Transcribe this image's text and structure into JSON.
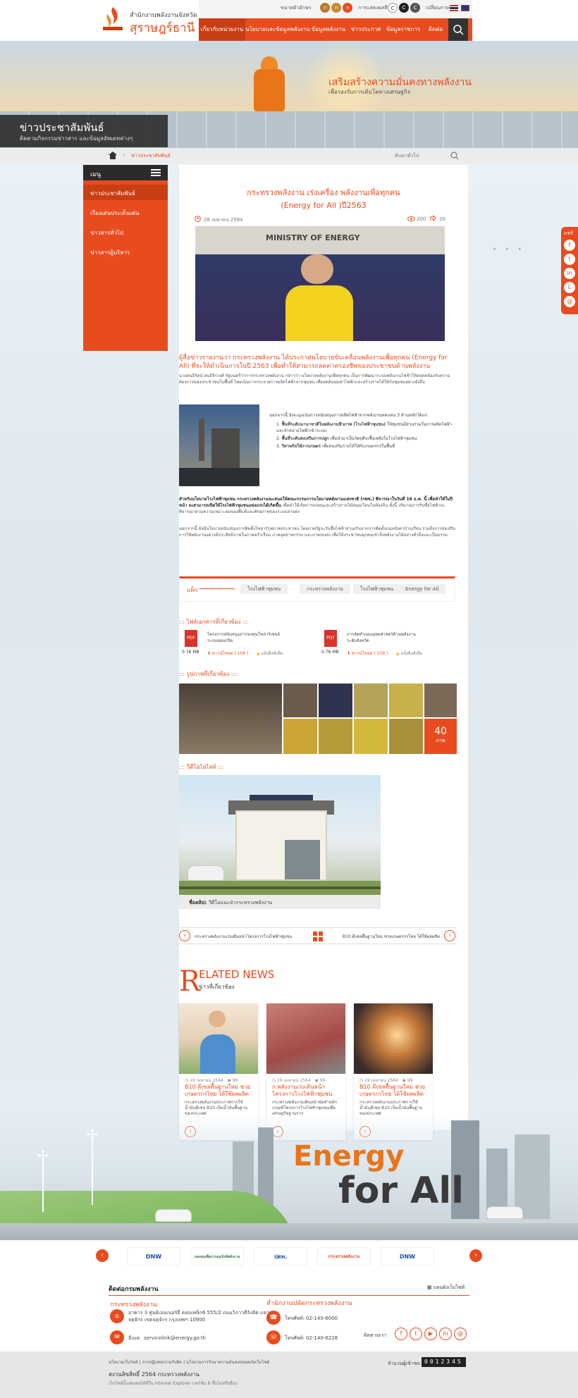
{
  "header": {
    "org_small": "สำนักงานพลังงานจังหวัด",
    "org_main": "สุราษฎร์ธานี",
    "font_size_label": "ขนาดตัวอักษร",
    "font_sizes": [
      "ก",
      "ก",
      "ก"
    ],
    "contrast_label": "การแสดงผลสี",
    "contrast_options": [
      "C",
      "C",
      "C"
    ],
    "lang_label": "เปลี่ยนภาษา",
    "nav": [
      "เกี่ยวกับหน่วยงาน",
      "นโยบายและข้อมูลพลังงาน",
      "ข้อมูลพลังงาน",
      "ข่าวประกาศ",
      "ข้อมูลราชการ",
      "ติดต่อ"
    ]
  },
  "banner": {
    "headline": "เสริมสร้างความมั่นคงทางพลังงาน",
    "sub": "เพื่อรองรับการเติบโตทางเศรษฐกิจ",
    "section_title": "ข่าวประชาสัมพันธ์",
    "section_sub": "ติดตามกิจกรรมข่าวสาร และข้อมูลอัพเดทต่างๆ"
  },
  "breadcrumb": {
    "current": "ข่าวประชาสัมพันธ์",
    "search_label": "ค้นหาทั่วไป"
  },
  "sidebar": {
    "title": "เมนู",
    "items": [
      "ข่าวประชาสัมพันธ์",
      "เรื่องเด่นประเด็นเด่น",
      "ข่าวสารทั่วไป",
      "ข่าวสารผู้บริหาร"
    ]
  },
  "share": {
    "label": "แชร์",
    "icons": [
      "f",
      "t",
      "in",
      "L",
      "@"
    ]
  },
  "article": {
    "title_line1": "กระทรวงพลังงาน เร่งเครื่อง พลังงานเพื่อทุกคน",
    "title_line2": "(Energy for All )ปี2563",
    "date": "28 เมษายน 2564",
    "views": "200",
    "shares": "20",
    "photo_banner": "MINISTRY OF ENERGY",
    "lead": "ผู้สื่อข่าวรายงานว่า กระทรวงพลังงาน ได้ประกาศนโยบายขับเคลื่อนพลังงานเพื่อทุกคน (Energy for All) ที่จะให้ดำเนินการในปี 2563 เพื่อทำให้สามารถลดค่าครองชีพของประชาชนด้านพลังงาน",
    "intro": "นายสนธิรัตน์ สนธิจิรวงศ์ รัฐมนตรีว่าการกระทรวงพลังงาน กล่าวว่า นโยบายพลังงานเพื่อทุกคน เป็นการพัฒนาระบบพลังงานไฟฟ้าให้สอดคล้องกับความต้องการของประชาชนในพื้นที่ โดยเน้นการกระจายการผลิตไฟฟ้าจากชุมชน เพื่อลดต้นทุนค่าไฟฟ้าและสร้างรายได้ให้กับชุมชนอย่างยั่งยืน",
    "bullet_intro": "นอกจากนี้ ยังจะมุ่งเน้นการสนับสนุนการผลิตไฟฟ้าจากพลังงานทดแทน 3 ด้านหลักได้แก่",
    "bullets": [
      {
        "bold": "ฟื้นที่ระดับนานาชาติในพลังงานชีวภาพ (โรงไฟฟ้าชุมชน)",
        "rest": " ให้ชุมชนมีส่วนร่วมในการผลิตไฟฟ้าและจำหน่ายไฟฟ้าเข้าระบบ"
      },
      {
        "bold": "พื้นที่ระดับส่งเสริมการปลูก",
        "rest": " เพื่อนำมาเป็นวัตถุดิบเชื้อเพลิงในโรงไฟฟ้าชุมชน"
      },
      {
        "bold": "วิสาหกิจให้การเกษตร",
        "rest": " เพื่อส่งเสริมรายได้ให้กับเกษตรกรในพื้นที่"
      }
    ],
    "para2_bold": "สำหรับนโยบายโรงไฟฟ้าชุมชน กระทรวงพลังงานจะเสนอให้คณะกรรมการนโยบายพลังงานแห่งชาติ (กพช.) พิจารณาในวันที่ 16 ธ.ค. นี้ เพื่อทำให้ในปีหน้า จะสามารถเปิดให้โรงไฟฟ้าชุมชนแห่งแรกได้เกิดขึ้น",
    "para2": " เพื่อทำให้เกิดการลงทุนและสร้างรายได้หมุนเวียนในท้องถิ่น ทั้งนี้ ปริมาณการรับซื้อไฟฟ้าจะพิจารณาตามความเหมาะสมของพื้นที่และศักยภาพของระบบสายส่ง",
    "para3": "นอกจากนี้ ยังมีนโยบายสนับสนุนการติดตั้งโซลาร์รูฟภาคประชาชน โดยภาครัฐจะรับซื้อไฟฟ้าส่วนเกินจากการติดตั้งบนหลังคาบ้านเรือน รวมถึงการส่งเสริมการใช้พลังงานอย่างมีประสิทธิภาพในภาคครัวเรือน ภาคอุตสาหกรรม และภาคขนส่ง เพื่อให้ประชาชนทุกคนเข้าถึงพลังงานได้อย่างทั่วถึงและเป็นธรรม"
  },
  "tags": {
    "label": "แท็ก",
    "items": [
      "โรงไฟฟ้าชุมชน",
      "กระทรวงพลังงาน",
      "โรงไฟฟ้าชุมชน",
      "Energy for All"
    ]
  },
  "files": {
    "title": "::: ไฟล์เอกสารที่เกี่ยวข้อง :::",
    "items": [
      {
        "name": "โครงการสนับสนุนการลงทุนโซล่าร์เซลล์ระบบออนกริด",
        "size": "0.78 MB",
        "download": "ดาวน์โหลด ( 109 )",
        "report": "แจ้งลิงค์เสีย"
      },
      {
        "name": "การจัดทำแผนยุทธศาสตร์ด้านพลังงานระดับจังหวัด",
        "size": "0.78 MB",
        "download": "ดาวน์โหลด ( 109 )",
        "report": "แจ้งลิงค์เสีย"
      }
    ]
  },
  "gallery": {
    "title": "::: รูปภาพที่เกี่ยวข้อง :::",
    "count": "40",
    "count_unit": "ภาพ"
  },
  "video": {
    "title": "::: วีดีโอไฮไลท์ :::",
    "caption_label": "ชื่อคลิป:",
    "caption": "วีดีโอแนะนำกระทรวงพลังงาน"
  },
  "pager": {
    "prev": "กระทรวงพลังงานเร่งเดินหน้าโครงการโรงไฟฟ้าชุมชน",
    "next": "B10 ดีเซลพื้นฐานใหม่ ช่วยเกษตรกรไทย ได้ใช้ผลผลิต"
  },
  "related": {
    "title_initial": "R",
    "title_rest": "ELATED NEWS",
    "sub": "ข่าวที่เกี่ยวข้อง",
    "cards": [
      {
        "date": "19 เมษายน 2564",
        "views": "99",
        "title": "B10 ดีเซลพื้นฐานใหม่ ช่วยเกษตรกรไทย ได้ใช้ผลผลิต",
        "desc": "กระทรวงพลังงานประกาศการใช้น้ำมันดีเซล B10 เป็นน้ำมันพื้นฐานของประเทศ"
      },
      {
        "date": "19 เมษายน 2564",
        "views": "99",
        "title": "ก.พลังงานเร่งเดินหน้าโครงการโรงไฟฟ้าชุมชน",
        "desc": "กระทรวงพลังงานเดินหน้าจัดทำหลักเกณฑ์โครงการโรงไฟฟ้าชุมชนเพื่อเศรษฐกิจฐานราก"
      },
      {
        "date": "19 เมษายน 2564",
        "views": "99",
        "title": "B10 ดีเซลพื้นฐานใหม่ ช่วยเกษตรกรไทย ได้ใช้ผลผลิต",
        "desc": "กระทรวงพลังงานประกาศการใช้น้ำมันดีเซล B10 เป็นน้ำมันพื้นฐานของประเทศ"
      }
    ]
  },
  "energy_art": {
    "line1": "Energy",
    "line2": "for All"
  },
  "partners": [
    "DNW",
    "กองทุนเพื่อการอนุรักษ์พลังงาน",
    "ปตท.",
    "กระทรวงพลังงาน",
    "DNW"
  ],
  "footer": {
    "heading": "ติดต่อกรมพลังงาน",
    "sitemap": "แผนผังเว็บไซต์",
    "ministry": "กระทรวงพลังงาน",
    "address": "อาคาร 3 ศูนย์เอนเนอร์ยี่ คอมเพล็กซ์ 555/2 ถนนวิภาวดีรังสิต แขวงจตุจักร เขตจตุจักร กรุงเทพฯ 10900",
    "email_label": "อีเมล:",
    "email": "servicelink@energy.go.th",
    "office": "สำนักงานปลัดกระทรวงพลังงาน",
    "phone1_label": "โทรศัพท์:",
    "phone1": "02-140-6000",
    "phone2_label": "โทรศัพท์:",
    "phone2": "02-140-6228",
    "follow": "ติดตามเรา",
    "socials": [
      "f",
      "t",
      "▶",
      "in",
      "@"
    ],
    "links": "นโยบายเว็บไซต์  |  การปฏิเสธความรับผิด  |  นโยบายการรักษาความมั่นคงปลอดภัยเว็บไซต์",
    "copyright": "สงวนลิขสิทธิ์ 2564 กระทรวงพลังงาน",
    "note": "เว็บไซต์นี้แสดงผลได้ดีใน Internet Explorer เวอร์ชั่น 8 ขึ้นไปหรืออื่นๆ",
    "counter_label": "จำนวนผู้เข้าชม",
    "counter": "0012345"
  },
  "colors": {
    "accent": "#e84c1e",
    "dark": "#2b2b2b"
  }
}
